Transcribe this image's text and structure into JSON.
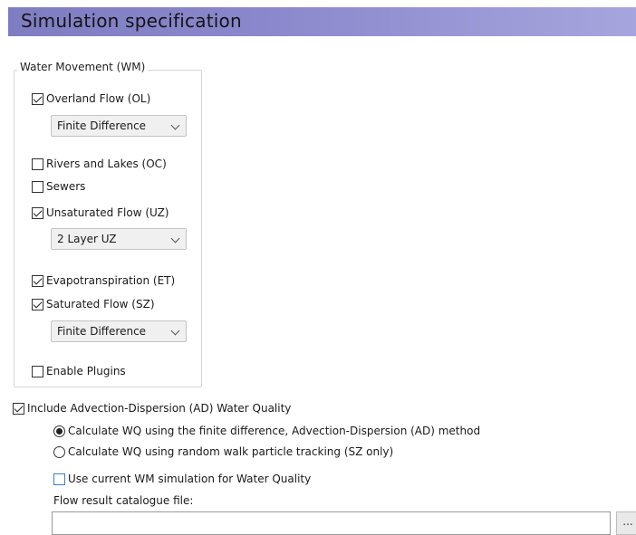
{
  "header": {
    "title": "Simulation specification"
  },
  "water_movement": {
    "group_title": "Water Movement (WM)",
    "overland_flow": {
      "label": "Overland Flow (OL)",
      "checked": true,
      "solver": "Finite Difference"
    },
    "rivers_lakes": {
      "label": "Rivers and Lakes (OC)",
      "checked": false
    },
    "sewers": {
      "label": "Sewers",
      "checked": false
    },
    "unsaturated_flow": {
      "label": "Unsaturated Flow (UZ)",
      "checked": true,
      "solver": "2 Layer UZ"
    },
    "evapotranspiration": {
      "label": "Evapotranspiration (ET)",
      "checked": true
    },
    "saturated_flow": {
      "label": "Saturated Flow (SZ)",
      "checked": true,
      "solver": "Finite Difference"
    },
    "plugins": {
      "label": "Enable Plugins",
      "checked": false
    }
  },
  "water_quality": {
    "include_ad": {
      "label": "Include Advection-Dispersion (AD) Water Quality",
      "checked": true
    },
    "method_fd": {
      "label": "Calculate WQ using the finite difference, Advection-Dispersion (AD) method",
      "selected": true
    },
    "method_rw": {
      "label": "Calculate WQ using random walk particle tracking (SZ only)",
      "selected": false
    },
    "use_current_wm": {
      "label": "Use current WM simulation for Water Quality",
      "checked": false
    },
    "flow_result_label": "Flow result catalogue file:",
    "flow_result_value": "",
    "browse_label": "..."
  },
  "colors": {
    "header_bar": "#8a87cc",
    "checkbox_accent": "#3c7fc6"
  }
}
